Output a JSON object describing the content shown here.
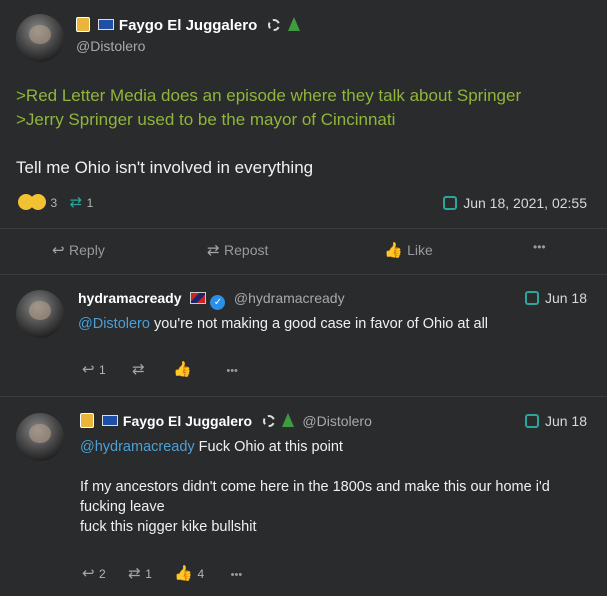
{
  "main_post": {
    "display_name": "Faygo El Juggalero",
    "handle": "@Distolero",
    "greentext": [
      ">Red Letter Media does an episode where they talk about Springer",
      ">Jerry Springer used to be the mayor of Cincinnati"
    ],
    "body": "Tell me Ohio isn't involved in everything",
    "reaction_count": "3",
    "repost_count": "1",
    "timestamp": "Jun 18, 2021, 02:55",
    "actions": {
      "reply": "Reply",
      "repost": "Repost",
      "like": "Like",
      "more": "•••"
    }
  },
  "replies": [
    {
      "display_name": "hydramacready",
      "handle": "@hydramacready",
      "mention": "@Distolero",
      "text": " you're not making a good case in favor of Ohio at all",
      "date": "Jun 18",
      "reply_count": "1",
      "repost_count": "",
      "like_count": "",
      "more": "•••"
    },
    {
      "display_name": "Faygo El Juggalero",
      "handle": "@Distolero",
      "mention": "@hydramacready",
      "text": " Fuck Ohio at this point",
      "lines": [
        "If my ancestors didn't come here in the 1800s and make this our home i'd",
        "fucking leave",
        "fuck this nigger kike bullshit"
      ],
      "date": "Jun 18",
      "reply_count": "2",
      "repost_count": "1",
      "like_count": "4",
      "more": "•••"
    }
  ],
  "colors": {
    "background": "#2a2b2d",
    "greentext": "#8fb53a",
    "mention": "#4d9fd6",
    "globe": "#2ea59a"
  }
}
